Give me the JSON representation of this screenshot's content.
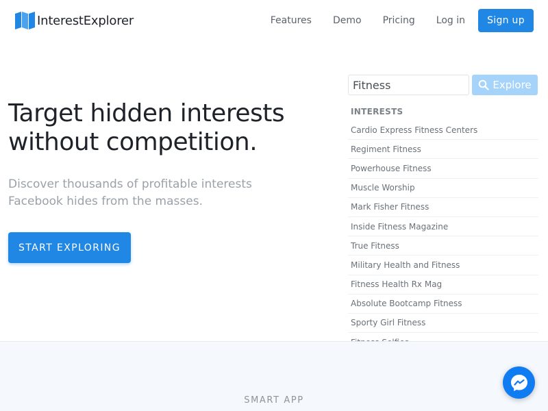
{
  "brand": {
    "name": "InterestExplorer",
    "accent": "#2088e4"
  },
  "nav": {
    "links": [
      "Features",
      "Demo",
      "Pricing",
      "Log in"
    ],
    "signup_label": "Sign up"
  },
  "hero": {
    "title": "Target hidden interests without competition.",
    "subtitle": "Discover thousands of profitable interests Facebook hides from the masses.",
    "cta_label": "START EXPLORING"
  },
  "search": {
    "value": "Fitness",
    "button_label": "Explore",
    "button_icon": "search-icon"
  },
  "interests": {
    "heading": "INTERESTS",
    "items": [
      "Cardio Express Fitness Centers",
      "Regiment Fitness",
      "Powerhouse Fitness",
      "Muscle Worship",
      "Mark Fisher Fitness",
      "Inside Fitness Magazine",
      "True Fitness",
      "Military Health and Fitness",
      "Fitness Health Rx Mag",
      "Absolute Bootcamp Fitness",
      "Sporty Girl Fitness",
      "Fitness Selfies"
    ]
  },
  "section": {
    "label": "SMART APP"
  },
  "chat_widget": {
    "icon": "messenger-icon",
    "color": "#0f7cf2"
  }
}
